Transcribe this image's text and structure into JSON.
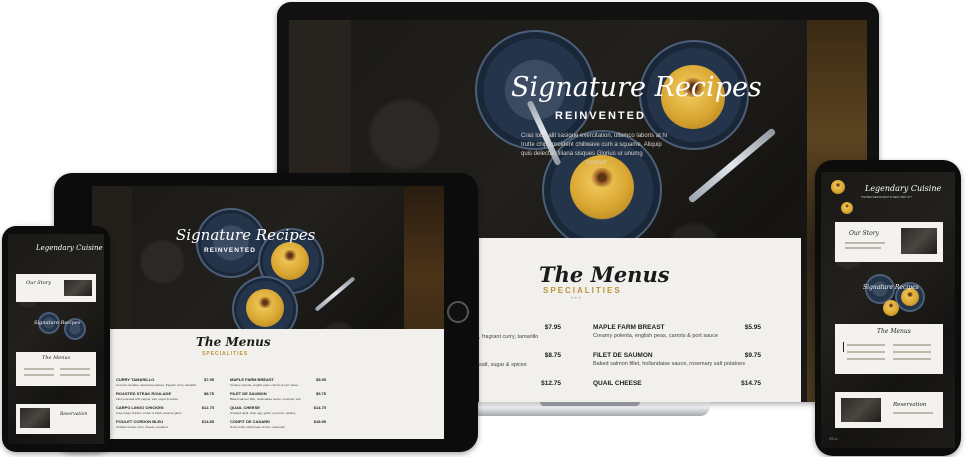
{
  "hero": {
    "title_script": "Signature Recipes",
    "title_caps": "REINVENTED",
    "body_lines": [
      "Cras lobo alit sasique exercitation, ullamco laboris at hi",
      "Irutte chips proident chillwave cum a squame. Aliquip",
      "quis delectus liliana sisques Glorius ur unumg",
      "nostrud"
    ]
  },
  "menus": {
    "title_script": "The Menus",
    "subtitle": "SPECIALITIES",
    "dots": "• • •"
  },
  "laptop_menu": {
    "left": [
      {
        "price": "$7.95",
        "desc": ", fragrant curry, tamarillo"
      },
      {
        "price": "$8.75",
        "desc": "salt, sugar & spices"
      },
      {
        "price": "$12.75",
        "desc": ""
      }
    ],
    "right": [
      {
        "name": "MAPLE FARM BREAST",
        "price": "$5.95",
        "desc": "Creamy polenta, english peas, carrots & port sauce"
      },
      {
        "name": "FILET DE SAUMON",
        "price": "$9.75",
        "desc": "Baked salmon fillet, hollandaise sauce, rosemary salt potatoes"
      },
      {
        "name": "QUAIL CHEESE",
        "price": "$14.75",
        "desc": ""
      }
    ]
  },
  "tablet_menu": {
    "left": [
      {
        "name": "CURRY TAMARILLO",
        "price": "$7.95",
        "desc": "Coconut noodles, steamed potatoes, fragrant curry, tamarillo"
      },
      {
        "name": "ROASTED STEAK ROULADE",
        "price": "$8.75",
        "desc": "Filet pounded with pepper, salt, sugar & spices"
      },
      {
        "name": "CARPO LINGO CHICKEN",
        "price": "$12.75",
        "desc": "Free-range chicken, hoisin & black sesame glaze"
      },
      {
        "name": "POULET CORDON BLEU",
        "price": "$14.85",
        "desc": "Chicken breast, ham, cheese, breaded"
      }
    ],
    "right": [
      {
        "name": "MAPLE FARM BREAST",
        "price": "$5.95",
        "desc": "Creamy polenta, english peas, carrots & port sauce"
      },
      {
        "name": "FILET DE SAUMON",
        "price": "$9.75",
        "desc": "Baked salmon fillet, hollandaise sauce, rosemary salt"
      },
      {
        "name": "QUAIL CHEESE",
        "price": "$14.75",
        "desc": "Smoked quail, crisp egg, garlic, pecorino, parsley"
      },
      {
        "name": "CONFIT DE CANARD",
        "price": "$18.95",
        "desc": "Duck confit, white bean & ham, cassoulet"
      }
    ]
  },
  "phone": {
    "brand_script": "Legendary Cuisine",
    "brand_sub": "THE BEST RESTAURANT IN NEW YORK CITY",
    "story_title": "Our Story",
    "hero_script": "Signature Recipes",
    "hero_caps": "REINVENTED",
    "menus_title": "The Menus",
    "reservation_title": "Reservation",
    "footer_logo": "Blue"
  }
}
